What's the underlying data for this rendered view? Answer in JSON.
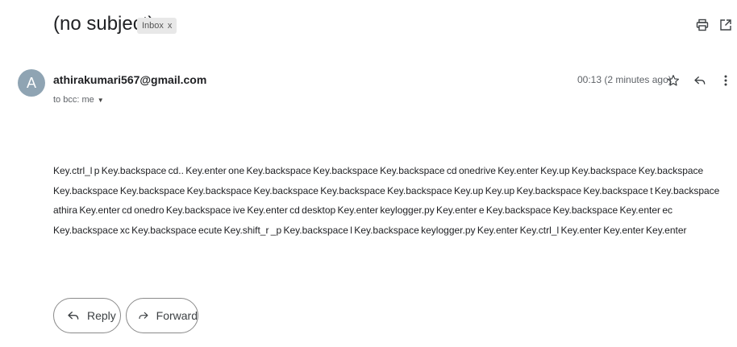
{
  "email": {
    "subject": "(no subject)",
    "label_chip": "Inbox",
    "label_chip_close": "x",
    "sender": {
      "avatar_letter": "A",
      "email": "athirakumari567@gmail.com",
      "recipients": "to bcc: me"
    },
    "timestamp": "00:13 (2 minutes ago)",
    "body": "Key.ctrl_l  p Key.backspace cd.. Key.enter one Key.backspace  Key.backspace  Key.backspace cd onedrive Key.enter  Key.up  Key.backspace  Key.backspace  Key.backspace  Key.backspace  Key.backspace  Key.backspace  Key.backspace  Key.backspace  Key.up  Key.up  Key.backspace  Key.backspace  t Key.backspace athira Key.enter cd onedro Key.backspace ive Key.enter cd desktop Key.enter keylogger.py Key.enter e Key.backspace  Key.backspace  Key.enter ec Key.backspace xc Key.backspace ecute Key.shift_r _p Key.backspace l Key.backspace keylogger.py Key.enter  Key.ctrl_l   Key.enter  Key.enter  Key.enter",
    "actions": {
      "reply": "Reply",
      "forward": "Forward"
    }
  },
  "icons": {
    "print": "print-icon",
    "open_new_window": "open-in-new-icon",
    "star": "star-icon",
    "reply": "reply-icon",
    "more": "more-vert-icon",
    "caret": "caret-down-icon",
    "forward": "forward-icon"
  },
  "colors": {
    "avatar_bg": "#8fa4b3",
    "chip_bg": "#e8e8e8",
    "text_primary": "#202124",
    "text_secondary": "#5f6368"
  }
}
